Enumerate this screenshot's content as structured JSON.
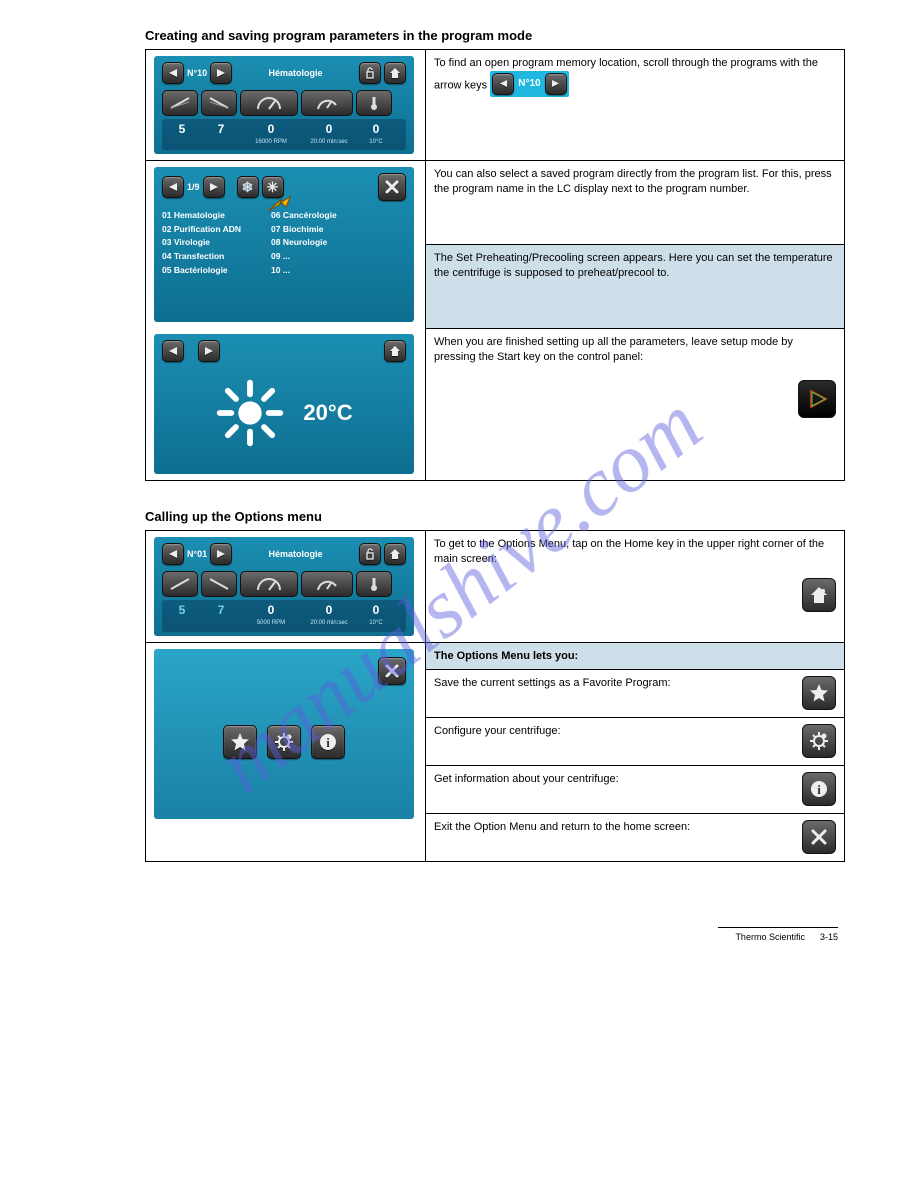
{
  "watermark": "manualshive.com",
  "section1": {
    "title": "Creating and saving program parameters in the program mode",
    "row1": {
      "device": {
        "n_label": "N°10",
        "name": "Hématologie",
        "vals": [
          "5",
          "7",
          "0",
          "0",
          "0"
        ],
        "subs": [
          "",
          "",
          "16000 RPM",
          "20:00 min:sec",
          "10°C"
        ]
      },
      "text": "To find an open program memory location, scroll through the programs with the arrow keys ",
      "thumb_mid": "N°10"
    },
    "row2": {
      "device": {
        "page": "1/9",
        "list_left": [
          "01 Hematologie",
          "02 Purification ADN",
          "03 Virologie",
          "04 Transfection",
          "05 Bactériologie"
        ],
        "list_right": [
          "06 Cancérologie",
          "07 Biochimie",
          "08 Neurologie",
          "09 ...",
          "10 ..."
        ]
      },
      "text1": "You can also select a saved program directly from the program list. For this, press the program name in the LC display next to the program number.",
      "text2": "The Set Preheating/Precooling screen appears. Here you can set the temperature the centrifuge is supposed to preheat/precool to.",
      "text3": "When you are finished setting up all the parameters, leave setup mode by pressing the Start key on the control panel:"
    },
    "row3": {
      "temp": "20°C"
    }
  },
  "section2": {
    "title": "Calling up the Options menu",
    "row1": {
      "device": {
        "n_label": "N°01",
        "name": "Hématologie",
        "vals": [
          "5",
          "7",
          "0",
          "0",
          "0"
        ],
        "subs": [
          "",
          "",
          "5000 RPM",
          "20:00 min:sec",
          "10°C"
        ]
      },
      "text": "To get to the Options Menu, tap on the Home key in the upper right corner of the main screen:"
    },
    "row2": {
      "right_header": "The Options Menu lets you:",
      "items": [
        "Save the current settings as a Favorite Program:",
        "Configure your centrifuge:",
        "Get information about your centrifuge:",
        "Exit the Option Menu and return to the home screen:"
      ]
    }
  },
  "footer": {
    "text1": "Thermo Scientific",
    "text2": "3-15"
  }
}
